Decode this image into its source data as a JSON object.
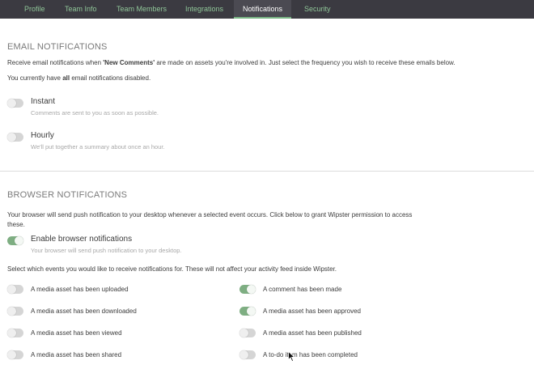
{
  "tabs": [
    {
      "label": "Profile"
    },
    {
      "label": "Team Info"
    },
    {
      "label": "Team Members"
    },
    {
      "label": "Integrations"
    },
    {
      "label": "Notifications",
      "active": true
    },
    {
      "label": "Security"
    }
  ],
  "email": {
    "title": "EMAIL NOTIFICATIONS",
    "desc_before": "Receive email notifications when ",
    "desc_bold": "'New Comments'",
    "desc_after": " are made on assets you're involved in. Just select the frequency you wish to receive these emails below.",
    "status_before": "You currently have ",
    "status_bold": "all",
    "status_after": " email notifications disabled.",
    "options": [
      {
        "title": "Instant",
        "subtitle": "Comments are sent to you as soon as possible.",
        "enabled": false
      },
      {
        "title": "Hourly",
        "subtitle": "We'll put together a summary about once an hour.",
        "enabled": false
      }
    ]
  },
  "browser": {
    "title": "BROWSER NOTIFICATIONS",
    "desc_line1": "Your browser will send push notification to your desktop whenever a selected event occurs. Click below to grant Wipster permission to access",
    "desc_line2": "these.",
    "enable": {
      "title": "Enable browser notifications",
      "subtitle": "Your browser will send push notification to your desktop.",
      "enabled": true
    },
    "events_intro": "Select which events you would like to receive notifications for. These will not affect your activity feed inside Wipster.",
    "events_left": [
      {
        "label": "A media asset has been uploaded",
        "enabled": false
      },
      {
        "label": "A media asset has been downloaded",
        "enabled": false
      },
      {
        "label": "A media asset has been viewed",
        "enabled": false
      },
      {
        "label": "A media asset has been shared",
        "enabled": false
      }
    ],
    "events_right": [
      {
        "label": "A comment has been made",
        "enabled": true
      },
      {
        "label": "A media asset has been approved",
        "enabled": true
      },
      {
        "label": "A media asset has been published",
        "enabled": false
      },
      {
        "label": "A to-do item has been completed",
        "enabled": false
      }
    ]
  },
  "colors": {
    "topbar": "#3b3a41",
    "tab_text": "#8fc598",
    "toggle_on": "#7eae82",
    "toggle_off": "#d5d5d5"
  }
}
